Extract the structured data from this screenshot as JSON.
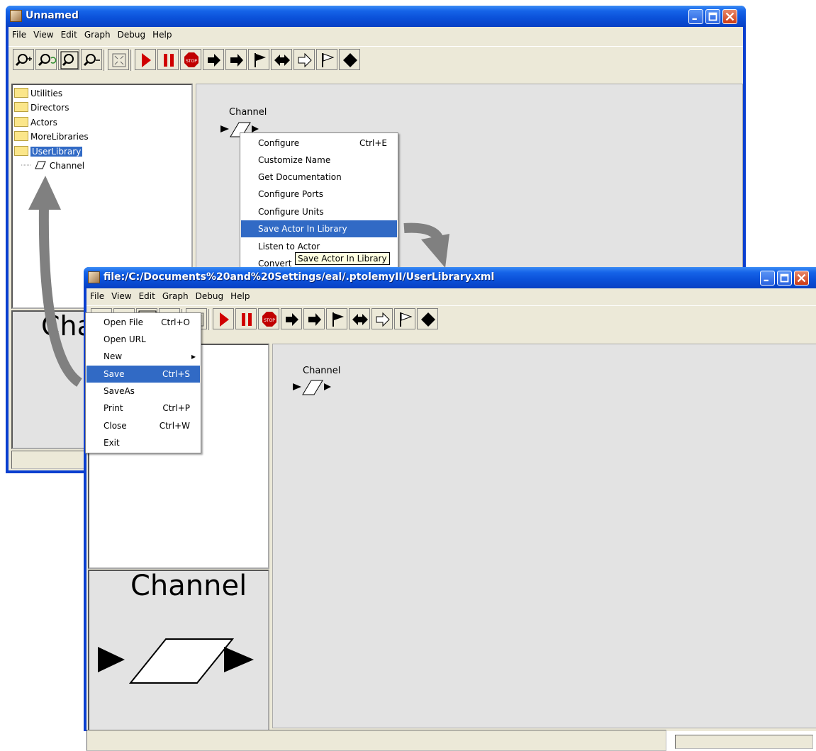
{
  "window1": {
    "title": "Unnamed",
    "menu": [
      "File",
      "View",
      "Edit",
      "Graph",
      "Debug",
      "Help"
    ],
    "tree": {
      "folders": [
        "Utilities",
        "Directors",
        "Actors",
        "MoreLibraries"
      ],
      "selected_folder": "UserLibrary",
      "child": "Channel"
    },
    "actor_label": "Channel",
    "preview_label": "Channel",
    "context_menu": {
      "items": [
        {
          "label": "Configure",
          "shortcut": "Ctrl+E"
        },
        {
          "label": "Customize Name",
          "shortcut": ""
        },
        {
          "label": "Get Documentation",
          "shortcut": ""
        },
        {
          "label": "Configure Ports",
          "shortcut": ""
        },
        {
          "label": "Configure Units",
          "shortcut": ""
        },
        {
          "label": "Save Actor In Library",
          "shortcut": ""
        },
        {
          "label": "Listen to Actor",
          "shortcut": ""
        },
        {
          "label": "Convert",
          "shortcut": ""
        }
      ],
      "highlighted": "Save Actor In Library",
      "tooltip": "Save Actor In Library"
    }
  },
  "window2": {
    "title": "file:/C:/Documents%20and%20Settings/eal/.ptolemyII/UserLibrary.xml",
    "menu": [
      "File",
      "View",
      "Edit",
      "Graph",
      "Debug",
      "Help"
    ],
    "file_menu": [
      {
        "label": "Open File",
        "shortcut": "Ctrl+O"
      },
      {
        "label": "Open URL",
        "shortcut": ""
      },
      {
        "label": "New",
        "shortcut": "▸"
      },
      {
        "label": "Save",
        "shortcut": "Ctrl+S"
      },
      {
        "label": "SaveAs",
        "shortcut": ""
      },
      {
        "label": "Print",
        "shortcut": "Ctrl+P"
      },
      {
        "label": "Close",
        "shortcut": "Ctrl+W"
      },
      {
        "label": "Exit",
        "shortcut": ""
      }
    ],
    "highlighted": "Save",
    "actor_label": "Channel",
    "preview_label": "Channel"
  },
  "toolbar_icons": [
    "zoom-in-icon",
    "zoom-reset-icon",
    "zoom-fit-icon",
    "zoom-out-icon",
    "full-screen-icon",
    "run-icon",
    "pause-icon",
    "stop-icon",
    "input-port-icon",
    "output-port-icon",
    "input-output-port-icon",
    "input-multiport-icon",
    "output-multiport-icon",
    "input-output-multiport-icon",
    "relation-icon"
  ],
  "colors": {
    "selection": "#316ac5",
    "titlebar": "#0a50d8",
    "run": "#d00000",
    "arrow": "#7f7f7f"
  }
}
